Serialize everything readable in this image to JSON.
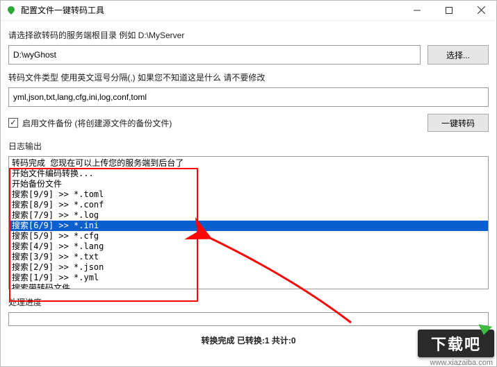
{
  "window": {
    "title": "配置文件一键转码工具"
  },
  "section1": {
    "label": "请选择欲转码的服务端根目录 例如 D:\\MyServer",
    "path_value": "D:\\wyGhost",
    "choose_btn": "选择..."
  },
  "section2": {
    "label": "转码文件类型 使用英文逗号分隔(,) 如果您不知道这是什么 请不要修改",
    "types_value": "yml,json,txt,lang,cfg,ini,log,conf,toml"
  },
  "backup": {
    "checked": true,
    "label": "启用文件备份 (将创建源文件的备份文件)",
    "convert_btn": "一键转码"
  },
  "log": {
    "title": "日志输出",
    "lines": [
      "转码完成 您现在可以上传您的服务端到后台了",
      "开始文件编码转换...",
      "开始备份文件",
      "搜索[9/9] >> *.toml",
      "搜索[8/9] >> *.conf",
      "搜索[7/9] >> *.log",
      "搜索[6/9] >> *.ini",
      "搜索[5/9] >> *.cfg",
      "搜索[4/9] >> *.lang",
      "搜索[3/9] >> *.txt",
      "搜索[2/9] >> *.json",
      "搜索[1/9] >> *.yml",
      "搜索带转码文件..."
    ],
    "selected_index": 6
  },
  "progress": {
    "label": "处理进度"
  },
  "status": "转换完成 已转换:1 共计:0",
  "watermark": {
    "badge": "下载吧",
    "url": "www.xiazaiba.com"
  }
}
